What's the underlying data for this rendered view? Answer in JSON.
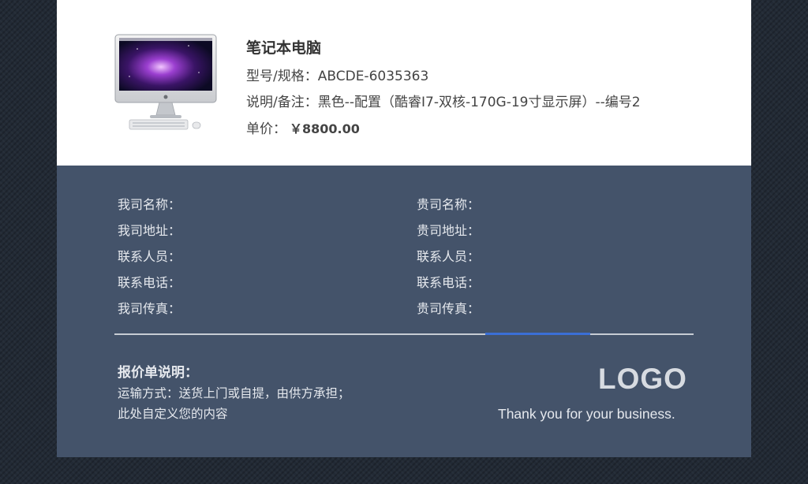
{
  "product": {
    "name": "笔记本电脑",
    "model_label": "型号/规格：",
    "model_value": "ABCDE-6035363",
    "desc_label": "说明/备注：",
    "desc_value": "黑色--配置（酷睿I7-双核-170G-19寸显示屏）--编号2",
    "price_label": "单价：",
    "price_value": "￥8800.00",
    "image_icon": "desktop-computer-icon"
  },
  "company": {
    "ours": [
      "我司名称：",
      "我司地址：",
      "联系人员：",
      "联系电话：",
      "我司传真："
    ],
    "theirs": [
      "贵司名称：",
      "贵司地址：",
      "联系人员：",
      "联系电话：",
      "贵司传真："
    ]
  },
  "notes": {
    "title": "报价单说明：",
    "lines": [
      "运输方式：送货上门或自提，由供方承担；",
      "此处自定义您的内容"
    ]
  },
  "brand": {
    "logo": "LOGO",
    "thanks": "Thank you for your business."
  },
  "colors": {
    "background": "#222a35",
    "footer": "#44536a",
    "accent": "#3b6fd6"
  }
}
